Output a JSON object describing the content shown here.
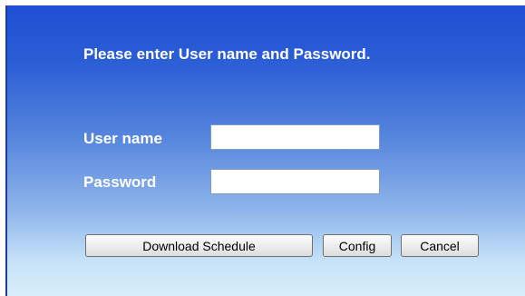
{
  "dialog": {
    "prompt": "Please enter User name and Password."
  },
  "form": {
    "username_label": "User name",
    "username_value": "",
    "password_label": "Password",
    "password_value": ""
  },
  "buttons": {
    "download_schedule": "Download Schedule",
    "config": "Config",
    "cancel": "Cancel"
  },
  "colors": {
    "panel_top": "#1f4fd3",
    "panel_bottom": "#d9effb",
    "label_text": "#ffffff"
  }
}
